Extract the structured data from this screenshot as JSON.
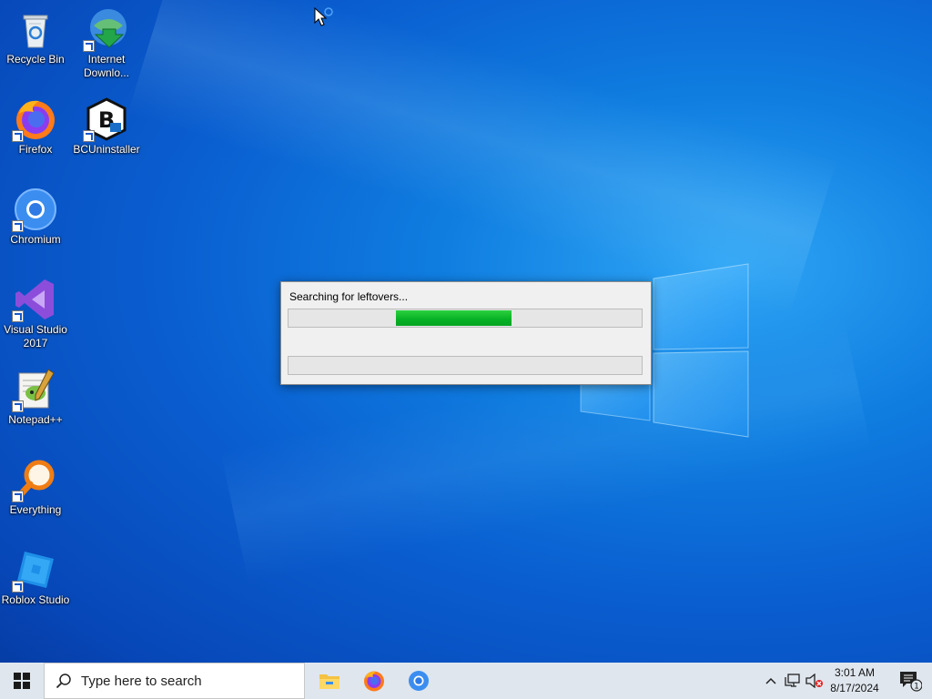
{
  "desktop": {
    "icons": [
      {
        "label": "Recycle Bin",
        "icon": "recycle-bin-icon"
      },
      {
        "label": "Internet Downlo...",
        "icon": "internet-download-manager-icon"
      },
      {
        "label": "Firefox",
        "icon": "firefox-icon"
      },
      {
        "label": "BCUninstaller",
        "icon": "bcuninstaller-icon"
      },
      {
        "label": "Chromium",
        "icon": "chromium-icon"
      },
      {
        "label": "Visual Studio 2017",
        "icon": "visual-studio-icon"
      },
      {
        "label": "Notepad++",
        "icon": "notepad-plus-plus-icon"
      },
      {
        "label": "Everything",
        "icon": "everything-search-icon"
      },
      {
        "label": "Roblox Studio",
        "icon": "roblox-studio-icon"
      }
    ]
  },
  "dialog": {
    "message": "Searching for leftovers...",
    "progress_color": "#06b025"
  },
  "taskbar": {
    "search_placeholder": "Type here to search",
    "pinned": [
      "file-explorer-icon",
      "firefox-icon",
      "chromium-icon"
    ],
    "tray": [
      "chevron-up-icon",
      "network-icon",
      "volume-muted-icon"
    ],
    "time": "3:01 AM",
    "date": "8/17/2024",
    "notification_count": "1"
  }
}
